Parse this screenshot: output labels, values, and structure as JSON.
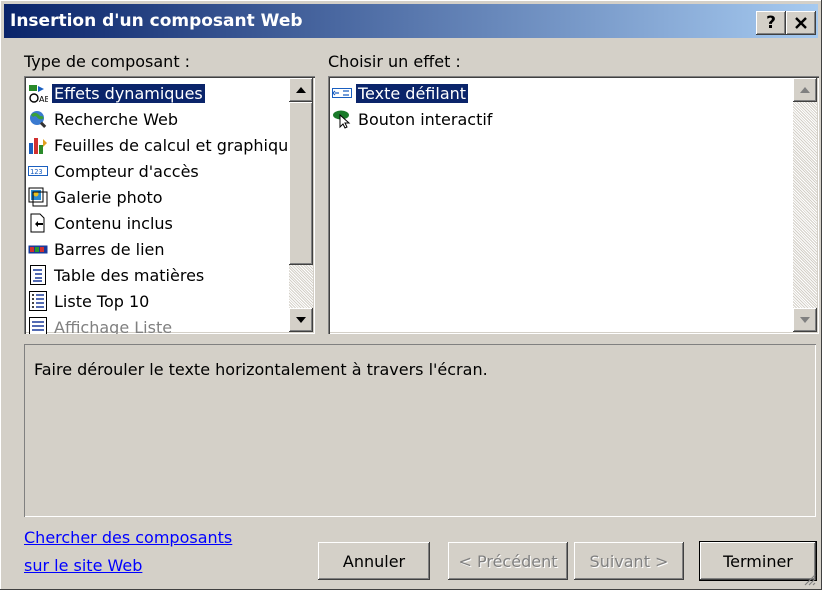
{
  "window": {
    "title": "Insertion d'un composant Web",
    "help_label": "?",
    "close_label": "x"
  },
  "left_panel": {
    "label": "Type de composant :",
    "items": [
      {
        "label": "Effets dynamiques",
        "icon": "dynamic-effects-icon",
        "selected": true
      },
      {
        "label": "Recherche Web",
        "icon": "web-search-icon"
      },
      {
        "label": "Feuilles de calcul et graphiques",
        "icon": "spreadsheet-chart-icon"
      },
      {
        "label": "Compteur d'accès",
        "icon": "hit-counter-icon"
      },
      {
        "label": "Galerie photo",
        "icon": "photo-gallery-icon"
      },
      {
        "label": "Contenu inclus",
        "icon": "included-content-icon"
      },
      {
        "label": "Barres de lien",
        "icon": "link-bars-icon"
      },
      {
        "label": "Table des matières",
        "icon": "table-of-contents-icon"
      },
      {
        "label": "Liste Top 10",
        "icon": "top10-list-icon"
      },
      {
        "label": "Affichage Liste",
        "icon": "list-view-icon",
        "disabled": true
      }
    ]
  },
  "right_panel": {
    "label": "Choisir un effet :",
    "items": [
      {
        "label": "Texte défilant",
        "icon": "marquee-icon",
        "selected": true
      },
      {
        "label": "Bouton interactif",
        "icon": "interactive-button-icon"
      }
    ]
  },
  "description": "Faire dérouler le texte horizontalement à travers l'écran.",
  "footer": {
    "link_line1": "Chercher des composants",
    "link_line2": "sur le site Web",
    "cancel": "Annuler",
    "previous": "< Précédent",
    "next": "Suivant >",
    "finish": "Terminer"
  },
  "colors": {
    "selection": "#0a246a",
    "title_start": "#0a246a",
    "title_end": "#a6caf0",
    "face": "#d4d0c8",
    "link": "#0000ff"
  }
}
